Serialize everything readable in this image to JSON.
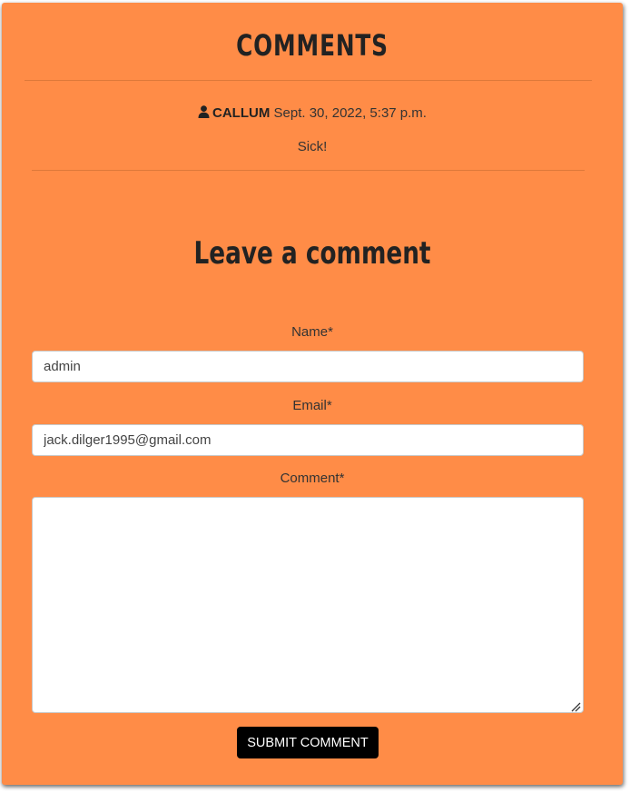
{
  "comments_section": {
    "title": "COMMENTS",
    "comments": [
      {
        "author": "CALLUM",
        "date": "Sept. 30, 2022, 5:37 p.m.",
        "body": "Sick!",
        "icon": "user-icon"
      }
    ]
  },
  "form": {
    "title": "Leave a comment",
    "name_label": "Name*",
    "name_value": "admin",
    "email_label": "Email*",
    "email_value": "jack.dilger1995@gmail.com",
    "comment_label": "Comment*",
    "comment_value": "",
    "submit_label": "SUBMIT COMMENT"
  },
  "colors": {
    "card_background": "#ff8c47",
    "text": "#333333",
    "button_background": "#000000",
    "button_text": "#ffffff"
  }
}
